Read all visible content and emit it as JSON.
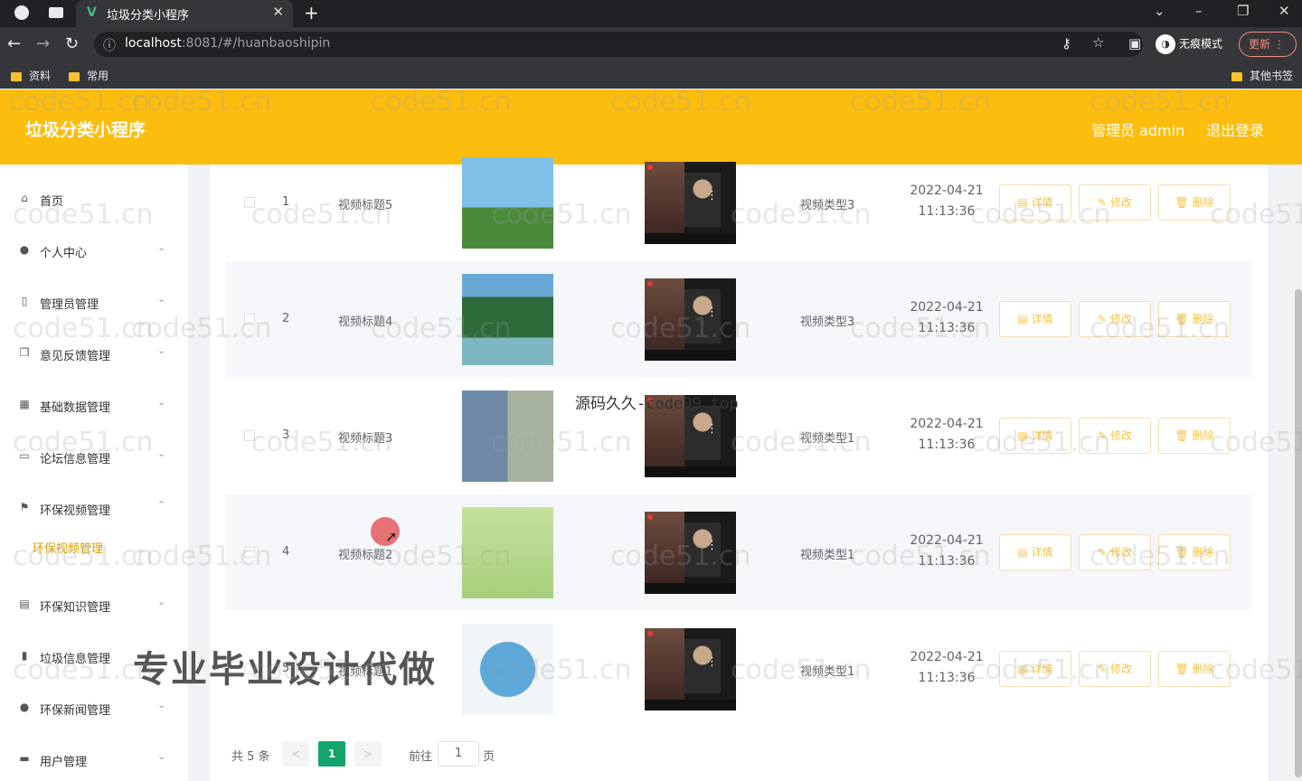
{
  "browser": {
    "tab_title": "垃圾分类小程序",
    "tab_close": "✕",
    "new_tab": "+",
    "url_host": "localhost",
    "url_path": ":8081/#/huanbaoshipin",
    "incognito_label": "无痕模式",
    "update_label": "更新",
    "bookmarks": [
      "资料",
      "常用"
    ],
    "other_bookmarks": "其他书签"
  },
  "header": {
    "brand": "垃圾分类小程序",
    "admin_label": "管理员 admin",
    "logout_label": "退出登录"
  },
  "sidebar": {
    "items": [
      {
        "label": "首页",
        "icon": "home-icon",
        "glyph": "⌂"
      },
      {
        "label": "个人中心",
        "icon": "user-icon",
        "glyph": "●",
        "arrow": "⌄"
      },
      {
        "label": "管理员管理",
        "icon": "phone-icon",
        "glyph": "▯",
        "arrow": "⌄"
      },
      {
        "label": "意见反馈管理",
        "icon": "copy-icon",
        "glyph": "❐",
        "arrow": "⌄"
      },
      {
        "label": "基础数据管理",
        "icon": "grid-icon",
        "glyph": "▦",
        "arrow": "⌄"
      },
      {
        "label": "论坛信息管理",
        "icon": "monitor-icon",
        "glyph": "▭",
        "arrow": "⌄"
      },
      {
        "label": "环保视频管理",
        "icon": "flag-icon",
        "glyph": "⚑",
        "arrow": "⌃"
      },
      {
        "label": "环保知识管理",
        "icon": "clipboard-icon",
        "glyph": "▤",
        "arrow": "⌄"
      },
      {
        "label": "垃圾信息管理",
        "icon": "bar-chart-icon",
        "glyph": "▮",
        "arrow": "⌄"
      },
      {
        "label": "环保新闻管理",
        "icon": "bulb-icon",
        "glyph": "●",
        "arrow": "⌄"
      },
      {
        "label": "用户管理",
        "icon": "chat-icon",
        "glyph": "▬",
        "arrow": "⌄"
      }
    ],
    "active_submenu": "环保视频管理"
  },
  "table": {
    "rows": [
      {
        "index": "1",
        "title": "视频标题5",
        "type": "视频类型3",
        "date": "2022-04-21",
        "time": "11:13:36"
      },
      {
        "index": "2",
        "title": "视频标题4",
        "type": "视频类型3",
        "date": "2022-04-21",
        "time": "11:13:36"
      },
      {
        "index": "3",
        "title": "视频标题3",
        "type": "视频类型1",
        "date": "2022-04-21",
        "time": "11:13:36"
      },
      {
        "index": "4",
        "title": "视频标题2",
        "type": "视频类型1",
        "date": "2022-04-21",
        "time": "11:13:36"
      },
      {
        "index": "5",
        "title": "视频标题1",
        "type": "视频类型1",
        "date": "2022-04-21",
        "time": "11:13:36"
      }
    ],
    "detail_label": "详情",
    "edit_label": "修改",
    "delete_label": "删除"
  },
  "pagination": {
    "total": "共 5 条",
    "prev": "<",
    "current": "1",
    "next": ">",
    "goto_label": "前往",
    "goto_value": "1",
    "page_suffix": "页"
  },
  "overlays": {
    "code99": "源码久久-code99.top",
    "promo": "专业毕业设计代做",
    "watermark": "code51.cn"
  }
}
